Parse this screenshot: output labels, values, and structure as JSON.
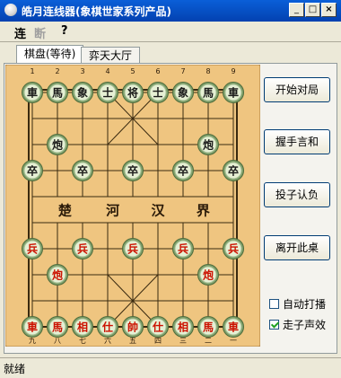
{
  "window": {
    "title": "皓月连线器(象棋世家系列产品)",
    "minimize": "_",
    "maximize": "□",
    "close": "×"
  },
  "menu": [
    "连",
    "断",
    "?"
  ],
  "tabs": [
    {
      "label": "棋盘(等待)",
      "active": true
    },
    {
      "label": "弈天大厅",
      "active": false
    }
  ],
  "board": {
    "river_text": [
      "楚",
      "河",
      "汉",
      "界"
    ],
    "top_file_numbers": [
      "1",
      "2",
      "3",
      "4",
      "5",
      "6",
      "7",
      "8",
      "9"
    ],
    "bottom_file_numbers": [
      "九",
      "八",
      "七",
      "六",
      "五",
      "四",
      "三",
      "二",
      "一"
    ],
    "pieces": [
      {
        "file": 0,
        "rank": 0,
        "label": "車",
        "side": "black"
      },
      {
        "file": 1,
        "rank": 0,
        "label": "馬",
        "side": "black"
      },
      {
        "file": 2,
        "rank": 0,
        "label": "象",
        "side": "black"
      },
      {
        "file": 3,
        "rank": 0,
        "label": "士",
        "side": "black"
      },
      {
        "file": 4,
        "rank": 0,
        "label": "将",
        "side": "black"
      },
      {
        "file": 5,
        "rank": 0,
        "label": "士",
        "side": "black"
      },
      {
        "file": 6,
        "rank": 0,
        "label": "象",
        "side": "black"
      },
      {
        "file": 7,
        "rank": 0,
        "label": "馬",
        "side": "black"
      },
      {
        "file": 8,
        "rank": 0,
        "label": "車",
        "side": "black"
      },
      {
        "file": 1,
        "rank": 2,
        "label": "炮",
        "side": "black"
      },
      {
        "file": 7,
        "rank": 2,
        "label": "炮",
        "side": "black"
      },
      {
        "file": 0,
        "rank": 3,
        "label": "卒",
        "side": "black"
      },
      {
        "file": 2,
        "rank": 3,
        "label": "卒",
        "side": "black"
      },
      {
        "file": 4,
        "rank": 3,
        "label": "卒",
        "side": "black"
      },
      {
        "file": 6,
        "rank": 3,
        "label": "卒",
        "side": "black"
      },
      {
        "file": 8,
        "rank": 3,
        "label": "卒",
        "side": "black"
      },
      {
        "file": 0,
        "rank": 6,
        "label": "兵",
        "side": "red"
      },
      {
        "file": 2,
        "rank": 6,
        "label": "兵",
        "side": "red"
      },
      {
        "file": 4,
        "rank": 6,
        "label": "兵",
        "side": "red"
      },
      {
        "file": 6,
        "rank": 6,
        "label": "兵",
        "side": "red"
      },
      {
        "file": 8,
        "rank": 6,
        "label": "兵",
        "side": "red"
      },
      {
        "file": 1,
        "rank": 7,
        "label": "炮",
        "side": "red"
      },
      {
        "file": 7,
        "rank": 7,
        "label": "炮",
        "side": "red"
      },
      {
        "file": 0,
        "rank": 9,
        "label": "車",
        "side": "red"
      },
      {
        "file": 1,
        "rank": 9,
        "label": "馬",
        "side": "red"
      },
      {
        "file": 2,
        "rank": 9,
        "label": "相",
        "side": "red"
      },
      {
        "file": 3,
        "rank": 9,
        "label": "仕",
        "side": "red"
      },
      {
        "file": 4,
        "rank": 9,
        "label": "帥",
        "side": "red"
      },
      {
        "file": 5,
        "rank": 9,
        "label": "仕",
        "side": "red"
      },
      {
        "file": 6,
        "rank": 9,
        "label": "相",
        "side": "red"
      },
      {
        "file": 7,
        "rank": 9,
        "label": "馬",
        "side": "red"
      },
      {
        "file": 8,
        "rank": 9,
        "label": "車",
        "side": "red"
      }
    ]
  },
  "buttons": {
    "start": "开始对局",
    "draw": "握手言和",
    "resign": "投子认负",
    "leave": "离开此桌"
  },
  "options": {
    "auto_play": {
      "label": "自动打播",
      "checked": false
    },
    "move_sound": {
      "label": "走子声效",
      "checked": true
    }
  },
  "status": "就绪",
  "colors": {
    "board": "#efc580",
    "grid": "#3a2a10",
    "red_piece": "#cc1100",
    "black_piece": "#1a1a1a",
    "piece_face": "#e6f0d4",
    "piece_rim": "#7fa06a"
  }
}
